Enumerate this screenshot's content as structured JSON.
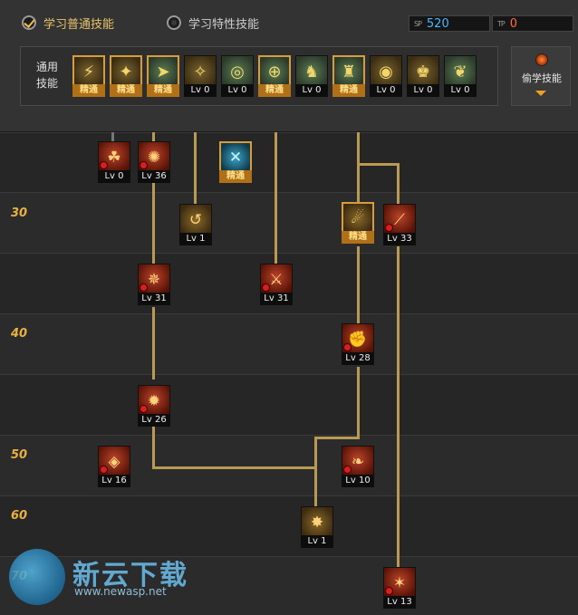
{
  "tabs": [
    {
      "label": "学习普通技能",
      "selected": true
    },
    {
      "label": "学习特性技能",
      "selected": false
    }
  ],
  "points": {
    "sp": {
      "icon_text": "SP",
      "value": "520",
      "color": "#4fb3ff"
    },
    "tp": {
      "icon_text": "TP",
      "value": "0",
      "color": "#ff6a3c"
    }
  },
  "common_skills": {
    "label": "通用技能",
    "mastered_text": "精通",
    "items": [
      {
        "icon": "kick-icon",
        "lv": "精通",
        "mastered": true
      },
      {
        "icon": "leap-icon",
        "lv": "精通",
        "mastered": true
      },
      {
        "icon": "dash-icon",
        "lv": "精通",
        "mastered": true
      },
      {
        "icon": "wing-icon",
        "lv": "Lv 0",
        "mastered": false
      },
      {
        "icon": "target-icon",
        "lv": "Lv 0",
        "mastered": false
      },
      {
        "icon": "aim-icon",
        "lv": "精通",
        "mastered": true
      },
      {
        "icon": "soldier-icon",
        "lv": "Lv 0",
        "mastered": false
      },
      {
        "icon": "hero-icon",
        "lv": "精通",
        "mastered": true
      },
      {
        "icon": "eye-icon",
        "lv": "Lv 0",
        "mastered": false
      },
      {
        "icon": "strength-icon",
        "lv": "Lv 0",
        "mastered": false
      },
      {
        "icon": "spirit-icon",
        "lv": "Lv 0",
        "mastered": false
      }
    ]
  },
  "steal_button": {
    "label": "偷学技能"
  },
  "level_labels": [
    "30",
    "40",
    "50",
    "60",
    "70"
  ],
  "skill_nodes": [
    {
      "icon": "poison-icon",
      "lv": "Lv 0",
      "mastered": false
    },
    {
      "icon": "flame-icon",
      "lv": "Lv 36",
      "mastered": false
    },
    {
      "icon": "crystal-icon",
      "lv": "精通",
      "mastered": true
    },
    {
      "icon": "whirl-icon",
      "lv": "Lv 1",
      "mastered": false
    },
    {
      "icon": "charge-icon",
      "lv": "精通",
      "mastered": true
    },
    {
      "icon": "claw-icon",
      "lv": "Lv 33",
      "mastered": false
    },
    {
      "icon": "burst-icon",
      "lv": "Lv 31",
      "mastered": false
    },
    {
      "icon": "strike-icon",
      "lv": "Lv 31",
      "mastered": false
    },
    {
      "icon": "fist-icon",
      "lv": "Lv 28",
      "mastered": false
    },
    {
      "icon": "blaze-icon",
      "lv": "Lv 26",
      "mastered": false
    },
    {
      "icon": "rune-icon",
      "lv": "Lv 16",
      "mastered": false
    },
    {
      "icon": "fang-icon",
      "lv": "Lv 10",
      "mastered": false
    },
    {
      "icon": "nova-icon",
      "lv": "Lv 1",
      "mastered": false
    },
    {
      "icon": "rampage-icon",
      "lv": "Lv 13",
      "mastered": false
    }
  ],
  "watermark": {
    "name": "新云下载",
    "url": "www.newasp.net"
  }
}
